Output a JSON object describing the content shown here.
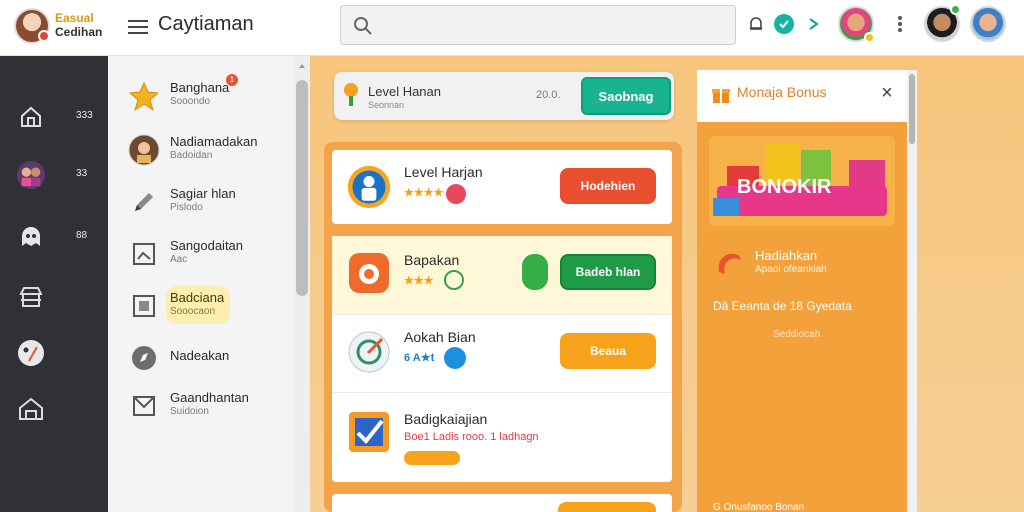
{
  "brand": {
    "line1": "Easual",
    "line2": "Cedihan"
  },
  "app_title": "Caytiaman",
  "search": {
    "placeholder": "",
    "value": ""
  },
  "rail": {
    "items": [
      {
        "icon": "house-icon",
        "count": "333"
      },
      {
        "icon": "avatar-group-icon",
        "count": "33"
      },
      {
        "icon": "ghost-icon",
        "count": "88"
      },
      {
        "icon": "store-icon",
        "count": ""
      },
      {
        "icon": "palette-icon",
        "count": ""
      },
      {
        "icon": "home-icon",
        "count": ""
      }
    ]
  },
  "sidebar": {
    "items": [
      {
        "label": "Banghana",
        "sub": "Sooondo",
        "icon": "star-icon",
        "badge": "1"
      },
      {
        "label": "Nadiamadakan",
        "sub": "Badoidan",
        "icon": "avatar-icon"
      },
      {
        "label": "Sagiar hlan",
        "sub": "Pislodo",
        "icon": "pencil-icon"
      },
      {
        "label": "Sangodaitan",
        "sub": "Aac",
        "icon": "image-icon"
      },
      {
        "label": "Badciana",
        "sub": "Sooocaon",
        "icon": "frame-icon"
      },
      {
        "label": "Nadeakan",
        "sub": "",
        "icon": "compass-icon"
      },
      {
        "label": "Gaandhantan",
        "sub": "Suidoion",
        "icon": "mail-icon"
      }
    ]
  },
  "level_bar": {
    "title": "Level Hanan",
    "sub": "Seonnan",
    "count": "20.0.",
    "button": "Saobnag"
  },
  "cards": [
    {
      "title": "Level Harjan",
      "meta": "★★★★",
      "button": "Hodehien",
      "color": "#e94e2f"
    },
    {
      "title": "Bapakan",
      "meta": "★★★",
      "button": "Badeb hlan",
      "color": "#1f9a46"
    },
    {
      "title": "Aokah Bian",
      "meta": "6 A★t",
      "button": "Beaua",
      "color": "#f7a21b"
    },
    {
      "title": "Badigkaiajian",
      "meta": "Boe1 Ladis rooo. 1 ladhagn",
      "button": "",
      "color": ""
    }
  ],
  "bonus": {
    "title": "Monaja Bonus",
    "close": "×",
    "banner": "BONOKIR",
    "row_title": "Hadiahkan",
    "row_sub": "Apaoi ofeankiah",
    "stats": "Dâ  Eeanta  de  18  Gyedata",
    "stats_sub": "Seddiocah",
    "footer": "G Onusfanoo Bonan"
  },
  "colors": {
    "accent": "#18b391",
    "orange": "#f3a23b",
    "rail": "#2f3136"
  }
}
